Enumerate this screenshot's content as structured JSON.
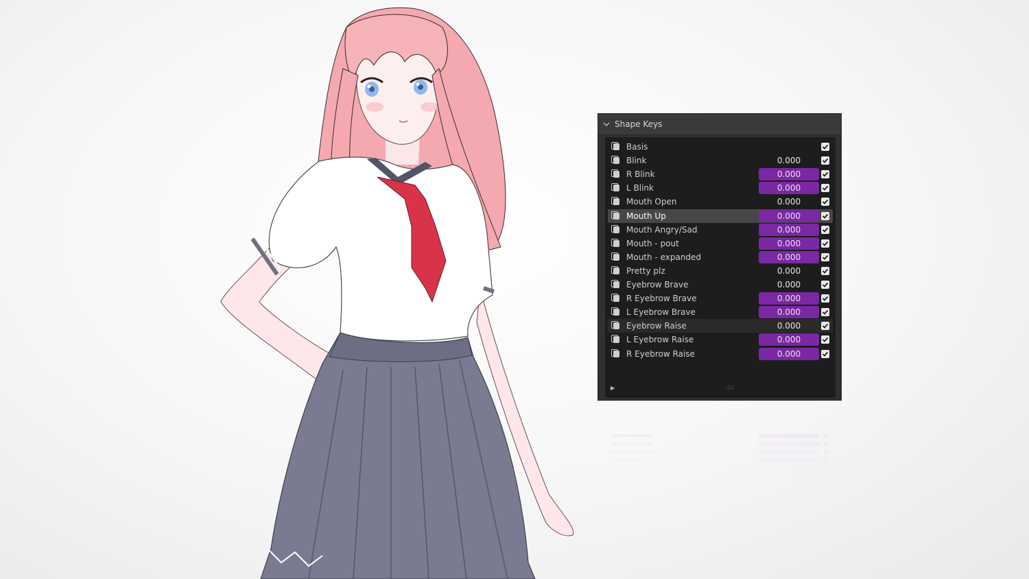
{
  "panel": {
    "title": "Shape Keys",
    "collapse_icon": "chevron-down-icon",
    "footer_icon": "triangle-right-icon",
    "grip": "::::"
  },
  "shape_keys": [
    {
      "name": "Basis",
      "value": "",
      "checked": true,
      "highlight": false,
      "state": "normal"
    },
    {
      "name": "Blink",
      "value": "0.000",
      "checked": true,
      "highlight": false,
      "state": "normal"
    },
    {
      "name": "R Blink",
      "value": "0.000",
      "checked": true,
      "highlight": true,
      "state": "normal"
    },
    {
      "name": "L Blink",
      "value": "0.000",
      "checked": true,
      "highlight": true,
      "state": "normal"
    },
    {
      "name": "Mouth Open",
      "value": "0.000",
      "checked": true,
      "highlight": false,
      "state": "normal"
    },
    {
      "name": "Mouth Up",
      "value": "0.000",
      "checked": true,
      "highlight": true,
      "state": "active"
    },
    {
      "name": "Mouth Angry/Sad",
      "value": "0.000",
      "checked": true,
      "highlight": true,
      "state": "normal"
    },
    {
      "name": "Mouth - pout",
      "value": "0.000",
      "checked": true,
      "highlight": true,
      "state": "normal"
    },
    {
      "name": "Mouth - expanded",
      "value": "0.000",
      "checked": true,
      "highlight": true,
      "state": "normal"
    },
    {
      "name": "Pretty plz",
      "value": "0.000",
      "checked": true,
      "highlight": false,
      "state": "normal"
    },
    {
      "name": "Eyebrow Brave",
      "value": "0.000",
      "checked": true,
      "highlight": false,
      "state": "normal"
    },
    {
      "name": "R Eyebrow Brave",
      "value": "0.000",
      "checked": true,
      "highlight": true,
      "state": "normal"
    },
    {
      "name": "L Eyebrow Brave",
      "value": "0.000",
      "checked": true,
      "highlight": true,
      "state": "normal"
    },
    {
      "name": "Eyebrow Raise",
      "value": "0.000",
      "checked": true,
      "highlight": false,
      "state": "hover"
    },
    {
      "name": "L Eyebrow Raise",
      "value": "0.000",
      "checked": true,
      "highlight": true,
      "state": "normal"
    },
    {
      "name": "R Eyebrow Raise",
      "value": "0.000",
      "checked": true,
      "highlight": true,
      "state": "normal"
    }
  ],
  "colors": {
    "panel_bg": "#303030",
    "list_bg": "#1d1d1d",
    "value_highlight": "#7a28a3",
    "active_row": "#474747",
    "hair": "#f6b3b8",
    "shirt": "#ffffff",
    "tie": "#d9334a",
    "skirt": "#7a7b90"
  }
}
